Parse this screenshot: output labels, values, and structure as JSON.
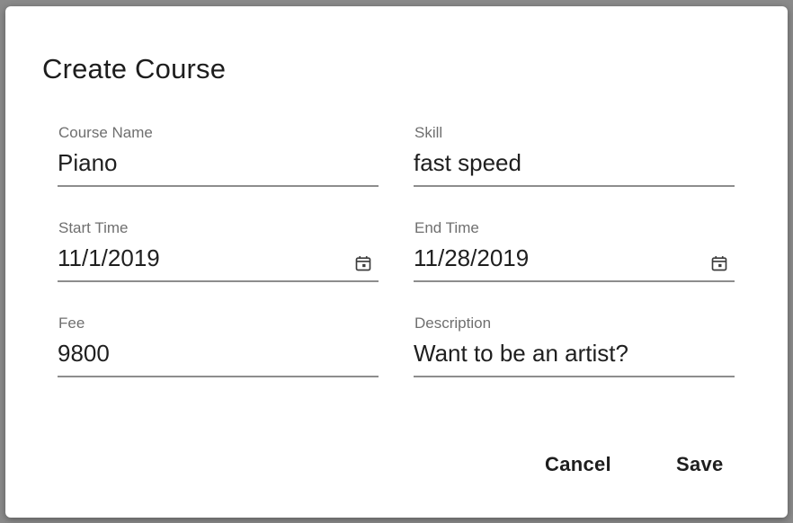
{
  "dialog": {
    "title": "Create Course"
  },
  "fields": {
    "course_name": {
      "label": "Course Name",
      "value": "Piano"
    },
    "skill": {
      "label": "Skill",
      "value": "fast speed"
    },
    "start_time": {
      "label": "Start Time",
      "value": "11/1/2019",
      "icon": "calendar-icon"
    },
    "end_time": {
      "label": "End Time",
      "value": "11/28/2019",
      "icon": "calendar-icon"
    },
    "fee": {
      "label": "Fee",
      "value": "9800"
    },
    "description": {
      "label": "Description",
      "value": "Want to be an artist?"
    }
  },
  "actions": {
    "cancel_label": "Cancel",
    "save_label": "Save"
  },
  "colors": {
    "backdrop": "#8a8a8a",
    "surface": "#ffffff",
    "text": "#1f1f1f",
    "label": "#6f6f6f",
    "underline": "#8d8d8d"
  }
}
